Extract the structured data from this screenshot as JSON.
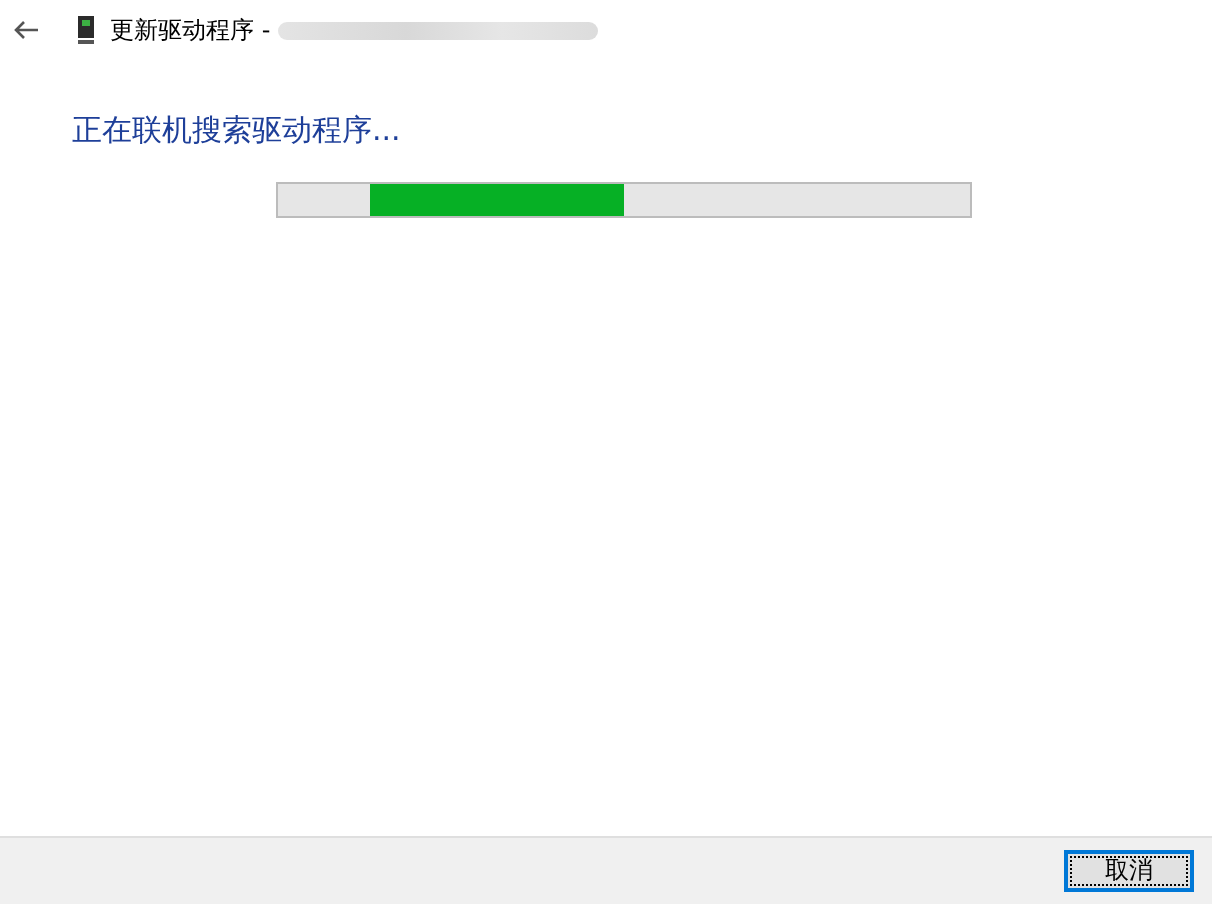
{
  "window": {
    "title": "更新驱动程序 -",
    "redacted": true
  },
  "heading": "正在联机搜索驱动程序...",
  "progress": {
    "kind": "marquee"
  },
  "buttons": [
    {
      "label": "取消",
      "focused": true
    }
  ]
}
